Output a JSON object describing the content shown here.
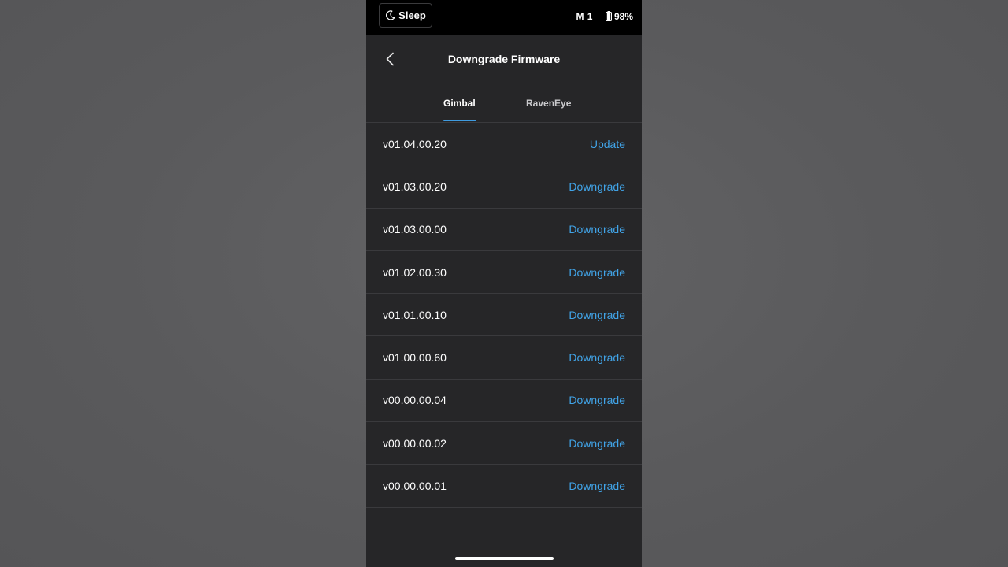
{
  "status_bar": {
    "sleep_label": "Sleep",
    "mode_label": "M 1",
    "battery_label": "98%"
  },
  "header": {
    "title": "Downgrade Firmware"
  },
  "tabs": [
    {
      "label": "Gimbal",
      "active": true
    },
    {
      "label": "RavenEye",
      "active": false
    }
  ],
  "firmware": [
    {
      "version": "v01.04.00.20",
      "action": "Update"
    },
    {
      "version": "v01.03.00.20",
      "action": "Downgrade"
    },
    {
      "version": "v01.03.00.00",
      "action": "Downgrade"
    },
    {
      "version": "v01.02.00.30",
      "action": "Downgrade"
    },
    {
      "version": "v01.01.00.10",
      "action": "Downgrade"
    },
    {
      "version": "v01.00.00.60",
      "action": "Downgrade"
    },
    {
      "version": "v00.00.00.04",
      "action": "Downgrade"
    },
    {
      "version": "v00.00.00.02",
      "action": "Downgrade"
    },
    {
      "version": "v00.00.00.01",
      "action": "Downgrade"
    }
  ],
  "colors": {
    "accent": "#41a4e8",
    "background": "#262628",
    "status_bar": "#000000"
  },
  "icons": {
    "back": "chevron-left-icon",
    "sleep": "moon-icon",
    "battery": "battery-icon"
  }
}
